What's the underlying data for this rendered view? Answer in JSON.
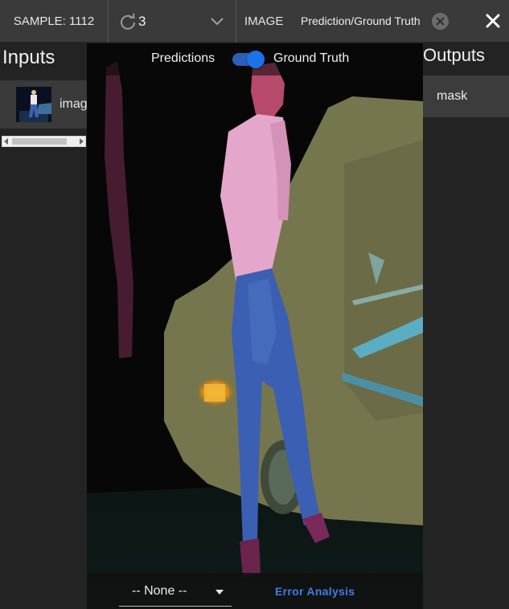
{
  "topbar": {
    "sample_label": "SAMPLE: 1112",
    "epoch_value": "3",
    "image_label": "IMAGE",
    "chip_label": "Prediction/Ground Truth"
  },
  "inputs": {
    "title": "Inputs",
    "items": [
      {
        "name": "image"
      }
    ]
  },
  "outputs": {
    "title": "Outputs",
    "items": [
      {
        "name": "mask"
      }
    ]
  },
  "viewer": {
    "left_label": "Predictions",
    "right_label": "Ground Truth",
    "toggle_state": "Ground Truth",
    "select_value": "-- None --",
    "error_button": "Error Analysis"
  },
  "colors": {
    "accent": "#1a73e8",
    "link": "#3b7ee6",
    "panel": "#232323",
    "topbar": "#3a3a3a",
    "mask_person": "#e8aed2",
    "mask_car": "#a9a97a"
  },
  "icons": {
    "epoch": "refresh-icon",
    "dropdown": "chevron-down-icon",
    "chip_remove": "circle-x-icon",
    "close": "close-icon"
  }
}
